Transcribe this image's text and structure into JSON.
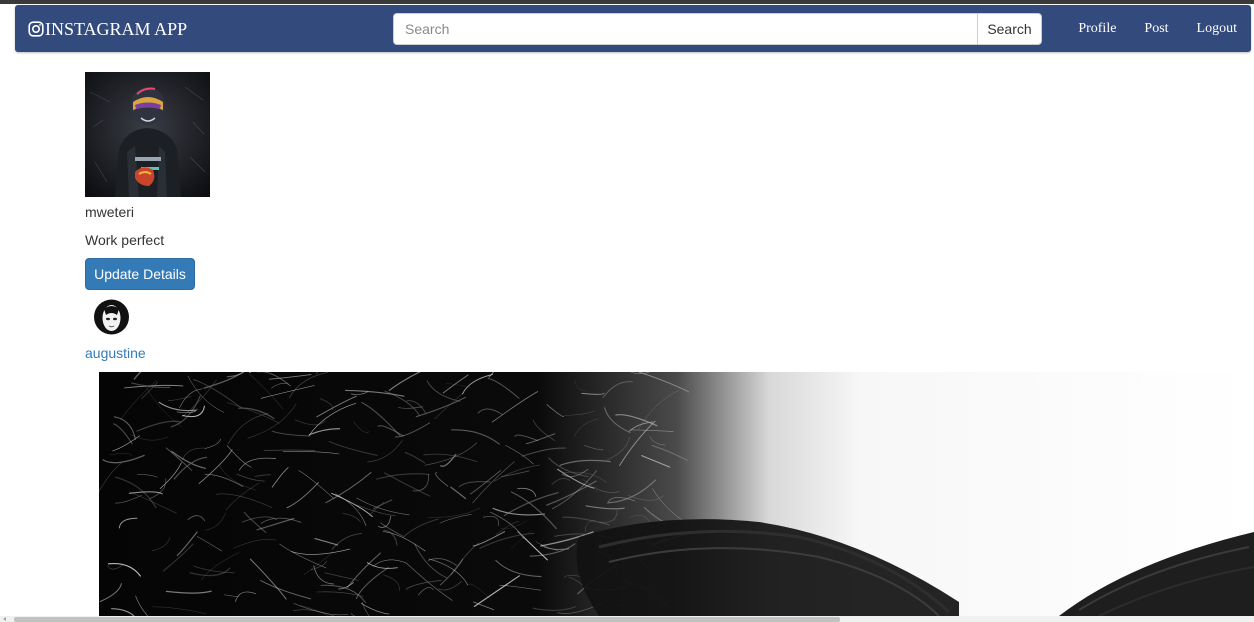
{
  "navbar": {
    "brand": "INSTAGRAM APP",
    "brand_icon": "instagram-camera-icon",
    "bg_color": "#334b7c",
    "search": {
      "placeholder": "Search",
      "value": "",
      "button_label": "Search"
    },
    "links": {
      "profile": "Profile",
      "post": "Post",
      "logout": "Logout"
    }
  },
  "profile": {
    "username": "mweteri",
    "bio": "Work perfect",
    "update_button": "Update Details",
    "button_color": "#337ab7"
  },
  "post": {
    "poster_name": "augustine",
    "link_color": "#337ab7"
  }
}
